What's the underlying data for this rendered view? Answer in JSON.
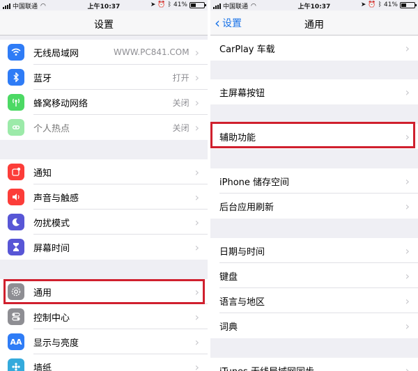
{
  "status_bar": {
    "carrier": "中国联通",
    "time": "上午10:37",
    "battery": "41%",
    "battery_level": 0.41
  },
  "left_panel": {
    "title": "设置",
    "group1": [
      {
        "label": "无线局域网",
        "value": "WWW.PC841.COM",
        "icon": "wifi-icon",
        "color": "#2f7cf6"
      },
      {
        "label": "蓝牙",
        "value": "打开",
        "icon": "bluetooth-icon",
        "color": "#2f7cf6"
      },
      {
        "label": "蜂窝移动网络",
        "value": "关闭",
        "icon": "antenna-icon",
        "color": "#4cd964"
      },
      {
        "label": "个人热点",
        "value": "关闭",
        "icon": "hotspot-icon",
        "color": "#4cd964"
      }
    ],
    "group2": [
      {
        "label": "通知",
        "icon": "notification-icon",
        "color": "#fc3d39"
      },
      {
        "label": "声音与触感",
        "icon": "speaker-icon",
        "color": "#fc3d39"
      },
      {
        "label": "勿扰模式",
        "icon": "moon-icon",
        "color": "#5856d6"
      },
      {
        "label": "屏幕时间",
        "icon": "hourglass-icon",
        "color": "#5856d6"
      }
    ],
    "group3": [
      {
        "label": "通用",
        "icon": "gear-icon",
        "color": "#8e8e93"
      },
      {
        "label": "控制中心",
        "icon": "toggle-icon",
        "color": "#8e8e93"
      },
      {
        "label": "显示与亮度",
        "icon": "text-size-icon",
        "color": "#2f7cf6"
      },
      {
        "label": "墙纸",
        "icon": "wallpaper-icon",
        "color": "#34aadc"
      }
    ]
  },
  "right_panel": {
    "back_label": "设置",
    "title": "通用",
    "rows": [
      {
        "label": "CarPlay 车载"
      },
      {
        "label": "主屏幕按钮"
      },
      {
        "label": "辅助功能"
      },
      {
        "label": "iPhone 储存空间"
      },
      {
        "label": "后台应用刷新"
      },
      {
        "label": "日期与时间"
      },
      {
        "label": "键盘"
      },
      {
        "label": "语言与地区"
      },
      {
        "label": "词典"
      },
      {
        "label": "iTunes 无线局域网同步"
      }
    ]
  },
  "colors": {
    "highlight": "#d0202e",
    "accent": "#1a73e8"
  }
}
